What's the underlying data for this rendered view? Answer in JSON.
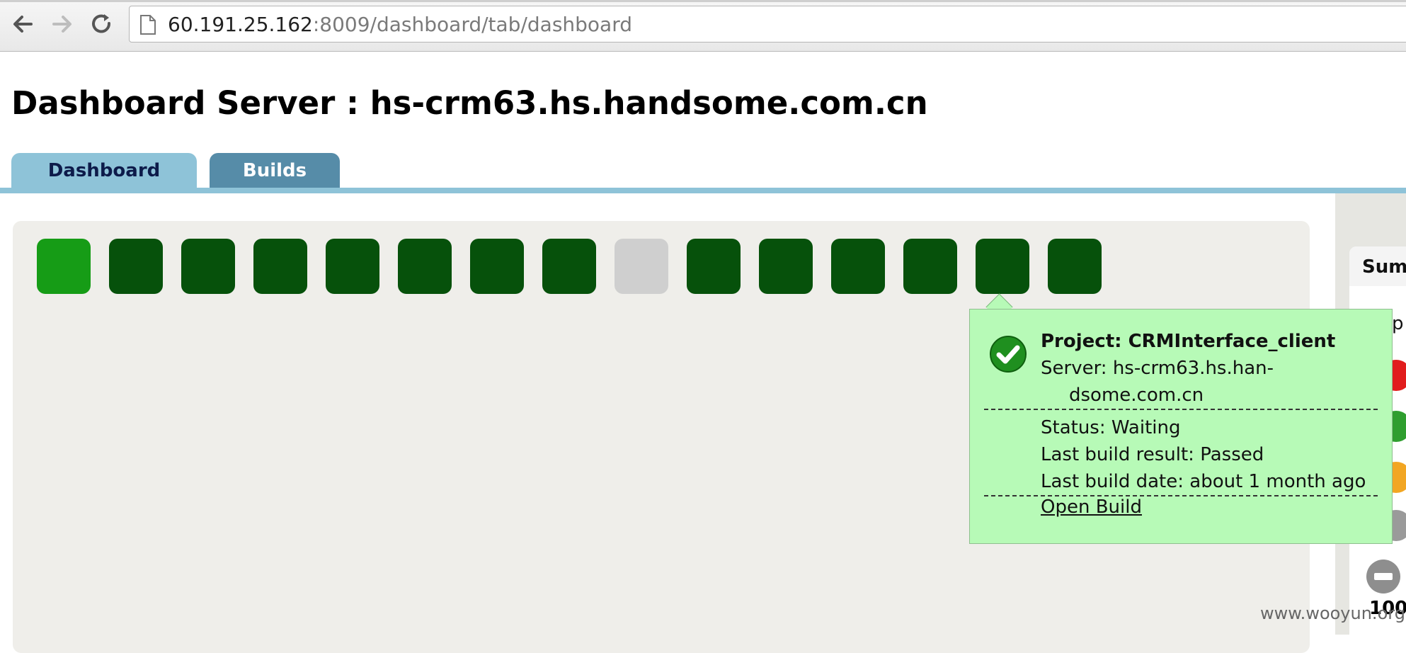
{
  "browser": {
    "url_host": "60.191.25.162",
    "url_rest": ":8009/dashboard/tab/dashboard"
  },
  "header": {
    "title": "Dashboard Server : hs-crm63.hs.handsome.com.cn"
  },
  "tabs": [
    {
      "label": "Dashboard",
      "active": true
    },
    {
      "label": "Builds",
      "active": false
    }
  ],
  "tiles": [
    {
      "status": "building-passed",
      "color": "#169c16"
    },
    {
      "status": "passed",
      "color": "#06510b"
    },
    {
      "status": "passed",
      "color": "#06510b"
    },
    {
      "status": "passed",
      "color": "#06510b"
    },
    {
      "status": "passed",
      "color": "#06510b"
    },
    {
      "status": "passed",
      "color": "#06510b"
    },
    {
      "status": "passed",
      "color": "#06510b"
    },
    {
      "status": "passed",
      "color": "#06510b"
    },
    {
      "status": "unknown",
      "color": "#cfcfcf"
    },
    {
      "status": "passed",
      "color": "#06510b"
    },
    {
      "status": "passed",
      "color": "#06510b"
    },
    {
      "status": "passed",
      "color": "#06510b"
    },
    {
      "status": "passed",
      "color": "#06510b"
    },
    {
      "status": "passed",
      "color": "#06510b"
    },
    {
      "status": "passed",
      "color": "#06510b"
    }
  ],
  "tooltip": {
    "project": "Project: CRMInterface_client",
    "server_line1": "Server: hs-crm63.hs.han-",
    "server_line2": "dsome.com.cn",
    "status": "Status: Waiting",
    "last_result": "Last build result: Passed",
    "last_date": "Last build date: about 1 month ago",
    "open_link": "Open Build"
  },
  "summary": {
    "title": "Sum",
    "partial_letter": "p",
    "count": "100",
    "dot_colors": [
      "#e11d1d",
      "#2f9e2f",
      "#f2a623",
      "#9a9a9a",
      "#8e8e8e"
    ]
  },
  "watermark": "www.wooyun.org"
}
